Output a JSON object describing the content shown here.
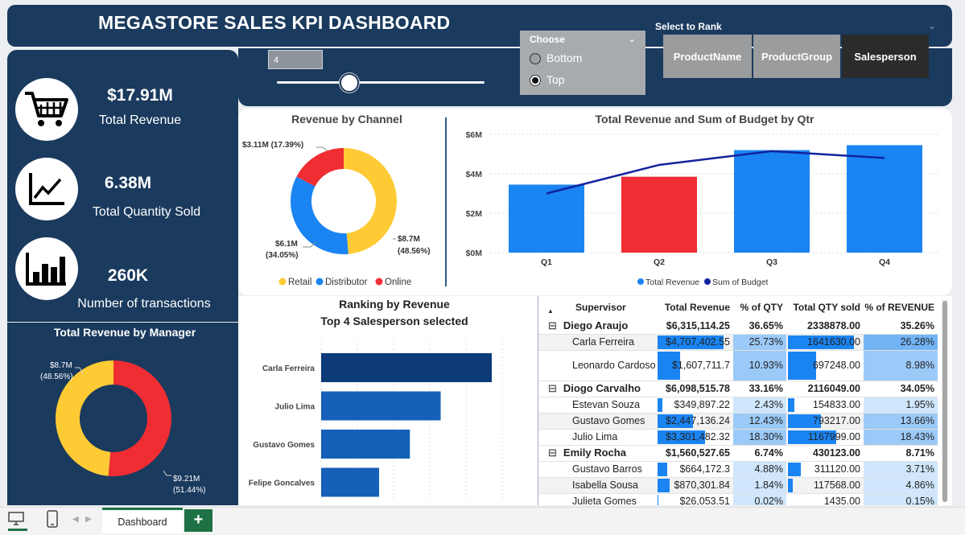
{
  "dashboard": {
    "title": "MEGASTORE SALES KPI DASHBOARD"
  },
  "kpis": [
    {
      "icon": "cart-icon",
      "value": "$17.91M",
      "label": "Total Revenue"
    },
    {
      "icon": "line-chart-icon",
      "value": "6.38M",
      "label": "Total Quantity Sold"
    },
    {
      "icon": "bar-chart-icon",
      "value": "260K",
      "label": "Number of transactions"
    }
  ],
  "controls": {
    "slider_value": "4",
    "slider_level": 0.35,
    "choose_label": "Choose",
    "options": [
      "Bottom",
      "Top"
    ],
    "selected_option": "Top",
    "rank_label": "Select to Rank",
    "rank_buttons": [
      "ProductName",
      "ProductGroup",
      "Salesperson"
    ],
    "selected_rank": "Salesperson"
  },
  "colors": {
    "navy": "#1a3a5e",
    "retail": "#fecb35",
    "distributor": "#1a84f2",
    "online": "#ef2d33",
    "budget_line": "#12239e",
    "rank_bar_top": "#0d3a78",
    "rank_bar": "#1560b8"
  },
  "charts": {
    "channel": {
      "title": "Revenue by Channel",
      "legend": [
        "Retail",
        "Distributor",
        "Online"
      ],
      "label_online": "$3.11M (17.39%)",
      "label_retail_a": "$8.7M",
      "label_retail_b": "(48.56%)",
      "label_dist_a": "$6.1M",
      "label_dist_b": "(34.05%)"
    },
    "quarterly": {
      "title": "Total Revenue and Sum of Budget by Qtr",
      "yticks": [
        "$6M",
        "$4M",
        "$2M",
        "$0M"
      ],
      "legend": [
        "Total Revenue",
        "Sum of Budget"
      ]
    },
    "manager": {
      "title": "Total Revenue by Manager",
      "label_a_1": "$8.7M",
      "label_a_2": "(48.56%)",
      "label_b_1": "$9.21M",
      "label_b_2": "(51.44%)"
    },
    "ranking": {
      "title": "Ranking by Revenue",
      "subtitle": "Top 4 Salesperson selected"
    }
  },
  "chart_data": [
    {
      "type": "pie",
      "title": "Revenue by Channel",
      "categories": [
        "Retail",
        "Distributor",
        "Online"
      ],
      "values": [
        8.7,
        6.1,
        3.11
      ],
      "percent": [
        48.56,
        34.05,
        17.39
      ],
      "unit": "$M",
      "legend": "bottom"
    },
    {
      "type": "bar",
      "title": "Total Revenue and Sum of Budget by Qtr",
      "categories": [
        "Q1",
        "Q2",
        "Q3",
        "Q4"
      ],
      "series": [
        {
          "name": "Total Revenue",
          "values": [
            3.45,
            3.85,
            5.2,
            5.45
          ]
        },
        {
          "name": "Sum of Budget",
          "type": "line",
          "values": [
            3.0,
            4.45,
            5.15,
            4.8
          ]
        }
      ],
      "highlight_index": 1,
      "ylim": [
        0,
        6
      ],
      "unit": "$M",
      "legend": "bottom"
    },
    {
      "type": "pie",
      "title": "Total Revenue by Manager",
      "values": [
        8.7,
        9.21
      ],
      "percent": [
        48.56,
        51.44
      ],
      "unit": "$M"
    },
    {
      "type": "bar",
      "orientation": "horizontal",
      "title": "Ranking by Revenue",
      "categories": [
        "Carla Ferreira",
        "Julio Lima",
        "Gustavo Gomes",
        "Felipe Goncalves"
      ],
      "values": [
        4.71,
        3.3,
        2.45,
        1.6
      ],
      "unit": "$M"
    }
  ],
  "table": {
    "headers": [
      "Supervisor",
      "Total Revenue",
      "% of QTY",
      "Total QTY sold",
      "% of REVENUE"
    ],
    "rows": [
      {
        "group": true,
        "name": "Diego Araujo",
        "rev": "$6,315,114.25",
        "pq": "36.65%",
        "qty": "2338878.00",
        "pr": "35.26%"
      },
      {
        "group": false,
        "name": "Carla Ferreira",
        "rev": "$4,707,402.55",
        "pq": "25.73%",
        "qty": "1641630.00",
        "pr": "26.28%",
        "rb": 0.97,
        "qb": 0.97,
        "pqs": 1,
        "prs": 2
      },
      {
        "group": false,
        "name": "Leonardo Cardoso",
        "rev": "$1,607,711.7",
        "pq": "10.93%",
        "qty": "697248.00",
        "pr": "8.98%",
        "rb": 0.33,
        "qb": 0.42,
        "pqs": 1,
        "prs": 1,
        "tall": true
      },
      {
        "group": true,
        "name": "Diogo Carvalho",
        "rev": "$6,098,515.78",
        "pq": "33.16%",
        "qty": "2116049.00",
        "pr": "34.05%"
      },
      {
        "group": false,
        "name": "Estevan Souza",
        "rev": "$349,897.22",
        "pq": "2.43%",
        "qty": "154833.00",
        "pr": "1.95%",
        "rb": 0.07,
        "qb": 0.09,
        "pqs": 0,
        "prs": 0
      },
      {
        "group": false,
        "name": "Gustavo Gomes",
        "rev": "$2,447,136.24",
        "pq": "12.43%",
        "qty": "793217.00",
        "pr": "13.66%",
        "rb": 0.52,
        "qb": 0.48,
        "pqs": 1,
        "prs": 1
      },
      {
        "group": false,
        "name": "Julio Lima",
        "rev": "$3,301,482.32",
        "pq": "18.30%",
        "qty": "1167999.00",
        "pr": "18.43%",
        "rb": 0.7,
        "qb": 0.71,
        "pqs": 1,
        "prs": 1
      },
      {
        "group": true,
        "name": "Emily Rocha",
        "rev": "$1,560,527.65",
        "pq": "6.74%",
        "qty": "430123.00",
        "pr": "8.71%"
      },
      {
        "group": false,
        "name": "Gustavo Barros",
        "rev": "$664,172.3",
        "pq": "4.88%",
        "qty": "311120.00",
        "pr": "3.71%",
        "rb": 0.14,
        "qb": 0.19,
        "pqs": 0,
        "prs": 0
      },
      {
        "group": false,
        "name": "Isabella Sousa",
        "rev": "$870,301.84",
        "pq": "1.84%",
        "qty": "117568.00",
        "pr": "4.86%",
        "rb": 0.18,
        "qb": 0.07,
        "pqs": 0,
        "prs": 0
      },
      {
        "group": false,
        "name": "Julieta Gomes",
        "rev": "$26,053.51",
        "pq": "0.02%",
        "qty": "1435.00",
        "pr": "0.15%",
        "rb": 0.01,
        "qb": 0.0,
        "pqs": 0,
        "prs": 0
      }
    ]
  },
  "footer": {
    "tab": "Dashboard",
    "add": "+"
  }
}
